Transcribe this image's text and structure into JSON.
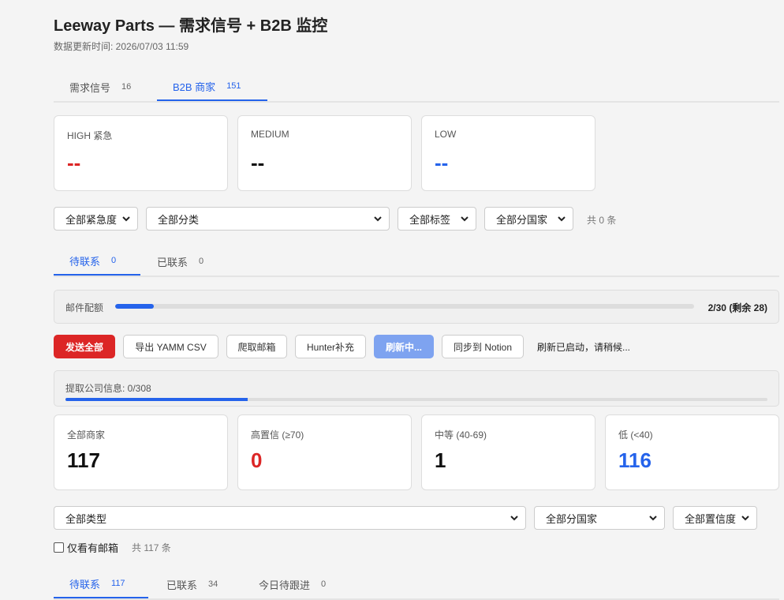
{
  "header": {
    "title": "Leeway Parts — 需求信号 + B2B 监控",
    "updated": "数据更新时间: 2026/07/03 11:59"
  },
  "main_tabs": [
    {
      "label": "需求信号",
      "count": "16"
    },
    {
      "label": "B2B 商家",
      "count": "151"
    }
  ],
  "urgency_cards": [
    {
      "label": "HIGH 紧急",
      "value": "--",
      "color": "#dc2626"
    },
    {
      "label": "MEDIUM",
      "value": "--",
      "color": "#111111"
    },
    {
      "label": "LOW",
      "value": "--",
      "color": "#2563eb"
    }
  ],
  "filters1": {
    "urgency": "全部紧急度",
    "category": "全部分类",
    "tag": "全部标签",
    "country": "全部分国家",
    "total": "共 0 条"
  },
  "contact_tabs": [
    {
      "label": "待联系",
      "count": "0"
    },
    {
      "label": "已联系",
      "count": "0"
    }
  ],
  "quota": {
    "label": "邮件配额",
    "used": 2,
    "limit": 30,
    "text": "2/30 (剩余 28)"
  },
  "actions": {
    "send_all": "发送全部",
    "export_csv": "导出 YAMM CSV",
    "crawl_email": "爬取邮箱",
    "hunter": "Hunter补充",
    "refreshing": "刷新中...",
    "notion": "同步到 Notion",
    "status": "刷新已启动，请稍候..."
  },
  "fetch": {
    "label": "提取公司信息: 0/308",
    "progress": 0.26
  },
  "merchant_stats": [
    {
      "label": "全部商家",
      "value": "117",
      "color": "#111111"
    },
    {
      "label": "高置信 (≥70)",
      "value": "0",
      "color": "#dc2626"
    },
    {
      "label": "中等 (40-69)",
      "value": "1",
      "color": "#111111"
    },
    {
      "label": "低 (<40)",
      "value": "116",
      "color": "#2563eb"
    }
  ],
  "filters2": {
    "type": "全部类型",
    "country": "全部分国家",
    "confidence": "全部置信度",
    "email_only": "仅看有邮箱",
    "total": "共 117 条"
  },
  "bottom_tabs": [
    {
      "label": "待联系",
      "count": "117"
    },
    {
      "label": "已联系",
      "count": "34"
    },
    {
      "label": "今日待跟进",
      "count": "0"
    }
  ],
  "icons": {
    "select_chevron": "chevron-down-icon",
    "checkbox": "checkbox-icon"
  },
  "colors": {
    "accent": "#2563eb",
    "danger": "#dc2626",
    "loading": "#7ea3f0"
  }
}
